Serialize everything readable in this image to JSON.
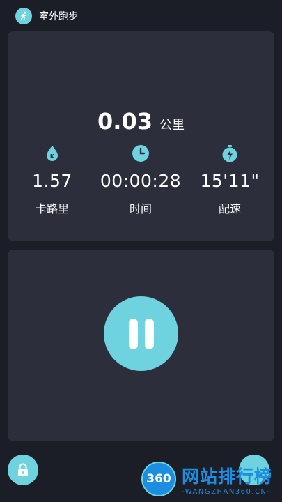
{
  "header": {
    "title": "室外跑步",
    "icon": "running-icon"
  },
  "stats": {
    "distance_value": "0.03",
    "distance_unit": "公里",
    "metrics": [
      {
        "icon": "calorie-drop-icon",
        "value": "1.57",
        "label": "卡路里"
      },
      {
        "icon": "clock-icon",
        "value": "00:00:28",
        "label": "时间"
      },
      {
        "icon": "stopwatch-lightning-icon",
        "value": "15'11\"",
        "label": "配速"
      }
    ]
  },
  "controls": {
    "pause_icon": "pause-icon",
    "lock_icon": "lock-icon"
  },
  "watermark": {
    "logo_text": "360",
    "cn_text": "网站排行榜",
    "en_text": "-WANGZHAN360.CN-"
  },
  "colors": {
    "accent": "#6ed3de",
    "background": "#1b1e27",
    "card": "#2c2f3b",
    "watermark": "#1c8ee0"
  }
}
